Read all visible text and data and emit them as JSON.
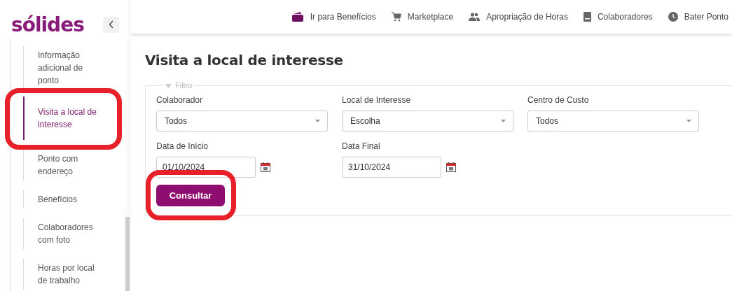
{
  "brand": {
    "logo": "sólides"
  },
  "nav_links": [
    {
      "label": "Ir para Benefícios",
      "kind": "wallet"
    },
    {
      "label": "Marketplace",
      "kind": "cart"
    },
    {
      "label": "Apropriação de Horas",
      "kind": "people"
    },
    {
      "label": "Colaboradores",
      "kind": "book"
    },
    {
      "label": "Bater Ponto",
      "kind": "clock"
    }
  ],
  "sidebar": {
    "items": [
      {
        "label": "Informação adicional de ponto",
        "selected": false,
        "highlighted": false
      },
      {
        "label": "Visita a local de interesse",
        "selected": true,
        "highlighted": true
      },
      {
        "label": "Ponto com endereço",
        "selected": false,
        "highlighted": false
      },
      {
        "label": "Benefícios",
        "selected": false,
        "highlighted": false
      },
      {
        "label": "Colaboradores com foto",
        "selected": false,
        "highlighted": false
      },
      {
        "label": "Horas por local de trabalho",
        "selected": false,
        "highlighted": false
      }
    ]
  },
  "page": {
    "title": "Visita a local de interesse",
    "filter": {
      "legend": "Filtro",
      "expanded": true,
      "selects": [
        {
          "label": "Colaborador",
          "value": "Todos"
        },
        {
          "label": "Local de Interesse",
          "value": "Escolha"
        },
        {
          "label": "Centro de Custo",
          "value": "Todos"
        }
      ],
      "dates": [
        {
          "label": "Data de Início",
          "value": "01/10/2024"
        },
        {
          "label": "Data Final",
          "value": "31/10/2024"
        }
      ],
      "submit": {
        "label": "Consultar",
        "highlighted": true
      }
    }
  }
}
